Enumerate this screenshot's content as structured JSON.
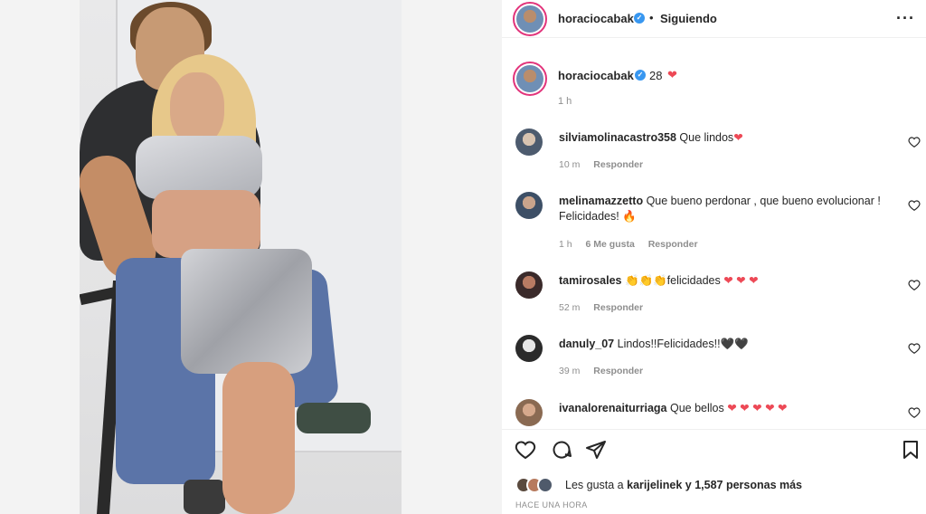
{
  "header": {
    "username": "horaciocabak",
    "verified": "✓",
    "separator": "•",
    "follow_state": "Siguiendo",
    "more_icon": "more-horizontal-icon"
  },
  "caption": {
    "username": "horaciocabak",
    "verified": "✓",
    "text": "28",
    "emoji": "❤",
    "time": "1 h"
  },
  "comments": [
    {
      "username": "silviamolinacastro358",
      "text": "Que lindos",
      "emoji": "❤",
      "time": "10 m",
      "likes": "",
      "reply": "Responder"
    },
    {
      "username": "melinamazzetto",
      "text": "Que bueno perdonar , que bueno evolucionar ! Felicidades!",
      "emoji": "🔥",
      "time": "1 h",
      "likes": "6 Me gusta",
      "reply": "Responder"
    },
    {
      "username": "tamirosales",
      "text": "👏👏👏felicidades",
      "emoji": "❤ ❤ ❤",
      "time": "52 m",
      "likes": "",
      "reply": "Responder"
    },
    {
      "username": "danuly_07",
      "text": "Lindos!!Felicidades!!",
      "emoji": "🖤🖤",
      "time": "39 m",
      "likes": "",
      "reply": "Responder"
    },
    {
      "username": "ivanalorenaiturriaga",
      "text": "Que bellos",
      "emoji": "❤ ❤ ❤ ❤ ❤",
      "time": "",
      "likes": "",
      "reply": ""
    }
  ],
  "actions": {
    "like_icon": "heart-outline-icon",
    "comment_icon": "comment-icon",
    "share_icon": "share-icon",
    "save_icon": "bookmark-icon"
  },
  "likes": {
    "prefix": "Les gusta a",
    "user": "karijelinek",
    "suffix": "y 1,587 personas más"
  },
  "timestamp": "HACE UNA HORA",
  "colors": {
    "heart_red": "#ed4956",
    "verified_blue": "#3897f0",
    "story_ring": "#e2347b",
    "muted": "#8e8e8e"
  }
}
